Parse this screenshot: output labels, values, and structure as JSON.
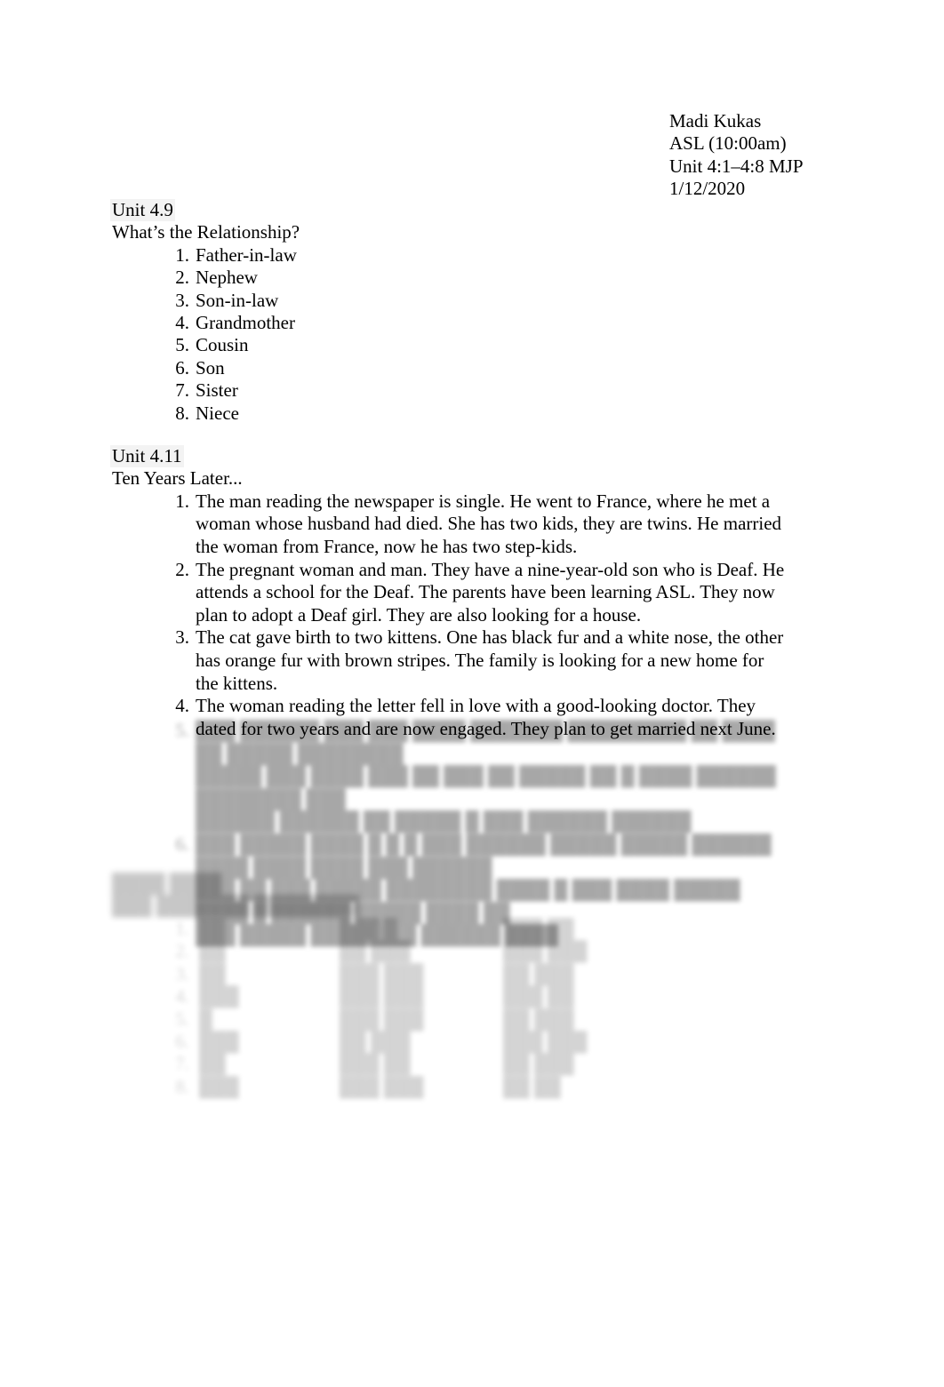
{
  "document": {
    "background_color": "#ffffff",
    "text_color": "#000000",
    "highlight_color": "#f3f3f3"
  },
  "header": {
    "student_name": "Madi Kukas",
    "course": "ASL (10:00am)",
    "assignment": "Unit 4:1–4:8 MJP",
    "date": "1/12/2020"
  },
  "sections": [
    {
      "id": "unit-4-9",
      "title": "Unit 4.9",
      "subtitle": "What’s the Relationship?",
      "legible": true,
      "items": [
        "Father-in-law",
        "Nephew",
        "Son-in-law",
        "Grandmother",
        "Cousin",
        "Son",
        "Sister",
        "Niece"
      ]
    },
    {
      "id": "unit-4-11",
      "title": "Unit 4.11",
      "subtitle": "Ten Years Later...",
      "legible": true,
      "items": [
        "The man reading the newspaper is single. He went to France, where he met a woman whose husband had died. She has two kids, they are twins. He married the woman from France, now he has two step-kids.",
        "The pregnant woman and man. They have a nine-year-old son who is Deaf. He attends a school for the Deaf. The parents have been learning ASL. They now plan to adopt a Deaf girl. They are also looking for a house.",
        "The cat gave birth to two kittens. One has black fur and a white nose, the other has orange fur with brown stripes. The family is looking for a new home for the kittens.",
        "The woman reading the letter fell in love with a good-looking doctor. They dated for two years and are now engaged. They plan to get married next June."
      ],
      "obscured_items": [
        {
          "number": "5.",
          "legible": false,
          "lines": [
            "███ ██████ ███ ███ ████ ███████ █████████ ██ ████ ██ █████ ████████",
            "█████ ███ ████ ███ ██ ███ ██ █████ ██ █ ████ ██████ ████████ ███",
            "██████ ██████ ██ █████ █ ███ ██████ ██████"
          ]
        },
        {
          "number": "6.",
          "legible": false,
          "lines": [
            "███ █████ ████ █ █ █ ███ ██████ █████ █████ ██████ ████ ████ ████ ███ ██████",
            "███ ██ ███ █████ ████████ ████ █ ███ ████ █████ ████ █ ██████ █████ ████ ██",
            "███ █████ ████████ ██████ ████"
          ]
        }
      ]
    },
    {
      "id": "unit-obscured",
      "title": "████ ████",
      "subtitle": "███ ███████ ████████",
      "legible": false,
      "note": "three-column numbered list, text unreadable due to blur",
      "rows": [
        {
          "number": "1.",
          "col1": "██",
          "col2": "███ █",
          "col3": "███ ██"
        },
        {
          "number": "2.",
          "col1": "██",
          "col2": "██ ███",
          "col3": "███ ███"
        },
        {
          "number": "3.",
          "col1": "██",
          "col2": "███ ███",
          "col3": "██ ███"
        },
        {
          "number": "4.",
          "col1": "███",
          "col2": "███ ███",
          "col3": "███ ██"
        },
        {
          "number": "5.",
          "col1": "█",
          "col2": "███ ███",
          "col3": "██ ███"
        },
        {
          "number": "6.",
          "col1": "███",
          "col2": "██ ███",
          "col3": "███ ███"
        },
        {
          "number": "7.",
          "col1": "██",
          "col2": "███ ██",
          "col3": "██ ███"
        },
        {
          "number": "8.",
          "col1": "███",
          "col2": "███ ███",
          "col3": "██ ██"
        }
      ]
    }
  ]
}
